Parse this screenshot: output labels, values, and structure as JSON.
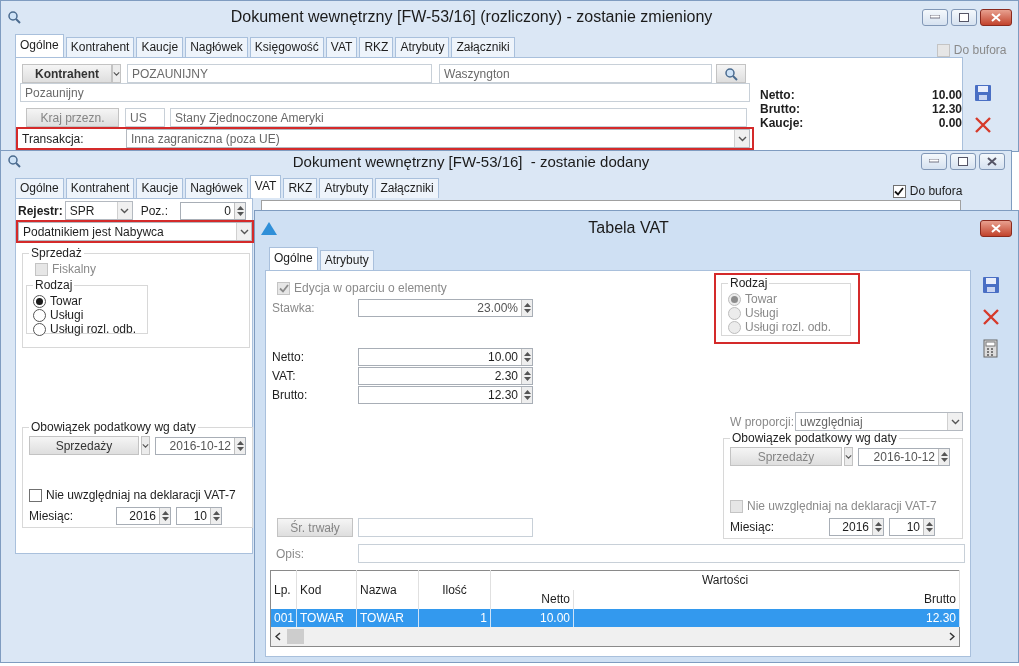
{
  "main_window": {
    "title": "Dokument wewnętrzny [FW-53/16] (rozliczony) - zostanie zmieniony",
    "tabs": [
      {
        "label": "Ogólne",
        "selected": true
      },
      {
        "label": "Kontrahent",
        "selected": false
      },
      {
        "label": "Kaucje",
        "selected": false
      },
      {
        "label": "Nagłówek",
        "selected": false
      },
      {
        "label": "Księgowość",
        "selected": false
      },
      {
        "label": "VAT",
        "selected": false
      },
      {
        "label": "RKZ",
        "selected": false
      },
      {
        "label": "Atrybuty",
        "selected": false
      },
      {
        "label": "Załączniki",
        "selected": false
      }
    ],
    "do_bufora": {
      "label": "Do bufora",
      "checked": false,
      "disabled": true
    },
    "kontrahent": {
      "button": "Kontrahent",
      "code": "POZAUNIJNY",
      "city": "Waszyngton",
      "name": "Pozaunijny"
    },
    "kraj": {
      "button": "Kraj przezn.",
      "code": "US",
      "name": "Stany Zjednoczone Ameryki"
    },
    "transakcja": {
      "label": "Transakcja:",
      "value": "Inna zagraniczna (poza UE)",
      "highlighted": true
    },
    "totals": [
      {
        "label": "Netto:",
        "value": "10.00"
      },
      {
        "label": "Brutto:",
        "value": "12.30"
      },
      {
        "label": "Kaucje:",
        "value": "0.00"
      }
    ]
  },
  "second_window": {
    "title": "Dokument wewnętrzny [FW-53/16]  - zostanie dodany",
    "tabs": [
      {
        "label": "Ogólne",
        "selected": false
      },
      {
        "label": "Kontrahent",
        "selected": false
      },
      {
        "label": "Kaucje",
        "selected": false
      },
      {
        "label": "Nagłówek",
        "selected": false
      },
      {
        "label": "VAT",
        "selected": true
      },
      {
        "label": "RKZ",
        "selected": false
      },
      {
        "label": "Atrybuty",
        "selected": false
      },
      {
        "label": "Załączniki",
        "selected": false
      }
    ],
    "do_bufora": {
      "label": "Do bufora",
      "checked": true,
      "disabled": false
    },
    "rejestr": {
      "label": "Rejestr:",
      "value": "SPR"
    },
    "poz": {
      "label": "Poz.:",
      "value": "0"
    },
    "podatnik": {
      "value": "Podatnikiem jest Nabywca",
      "highlighted": true
    },
    "sprzedaz": {
      "title": "Sprzedaż",
      "fiskalny": {
        "label": "Fiskalny",
        "checked": false,
        "disabled": true
      }
    },
    "rodzaj": {
      "title": "Rodzaj",
      "disabled": false,
      "options": [
        {
          "label": "Towar",
          "selected": true
        },
        {
          "label": "Usługi",
          "selected": false
        },
        {
          "label": "Usługi rozl. odb.",
          "selected": false
        }
      ]
    },
    "obowiazek": {
      "title": "Obowiązek podatkowy wg daty",
      "button": "Sprzedaży",
      "date": "2016-10-12",
      "disabled": false
    },
    "nie_uwzgledniaj": {
      "label": "Nie uwzględniaj na deklaracji VAT-7",
      "checked": false,
      "disabled": false
    },
    "miesiac": {
      "label": "Miesiąc:",
      "year": "2016",
      "month": "10"
    }
  },
  "vat_dialog": {
    "title": "Tabela VAT",
    "tabs": [
      {
        "label": "Ogólne",
        "selected": true
      },
      {
        "label": "Atrybuty",
        "selected": false
      }
    ],
    "edycja": {
      "label": "Edycja w oparciu o elementy",
      "checked": true,
      "disabled": true
    },
    "stawka": {
      "label": "Stawka:",
      "value": "23.00%"
    },
    "amounts": [
      {
        "label": "Netto:",
        "value": "10.00"
      },
      {
        "label": "VAT:",
        "value": "2.30"
      },
      {
        "label": "Brutto:",
        "value": "12.30"
      }
    ],
    "rodzaj": {
      "title": "Rodzaj",
      "disabled": true,
      "highlighted": true,
      "options": [
        {
          "label": "Towar",
          "selected": true
        },
        {
          "label": "Usługi",
          "selected": false
        },
        {
          "label": "Usługi rozl. odb.",
          "selected": false
        }
      ]
    },
    "w_proporcji": {
      "label": "W proporcji:",
      "value": "uwzględniaj"
    },
    "obowiazek": {
      "title": "Obowiązek podatkowy wg daty",
      "button": "Sprzedaży",
      "date": "2016-10-12",
      "disabled": true
    },
    "nie_uwzgledniaj": {
      "label": "Nie uwzględniaj na deklaracji VAT-7",
      "checked": false,
      "disabled": true
    },
    "miesiac": {
      "label": "Miesiąc:",
      "year": "2016",
      "month": "10"
    },
    "sr_trwaly": {
      "button": "Śr. trwały"
    },
    "opis": {
      "label": "Opis:"
    },
    "table": {
      "columns": [
        "Lp.",
        "Kod",
        "Nazwa",
        "Ilość"
      ],
      "column_group": {
        "label": "Wartości",
        "columns": [
          "Netto",
          "Brutto"
        ]
      },
      "rows": [
        {
          "cells": [
            "001",
            "TOWAR",
            "TOWAR",
            "1",
            "10.00",
            "12.30"
          ],
          "selected": true
        }
      ]
    }
  }
}
